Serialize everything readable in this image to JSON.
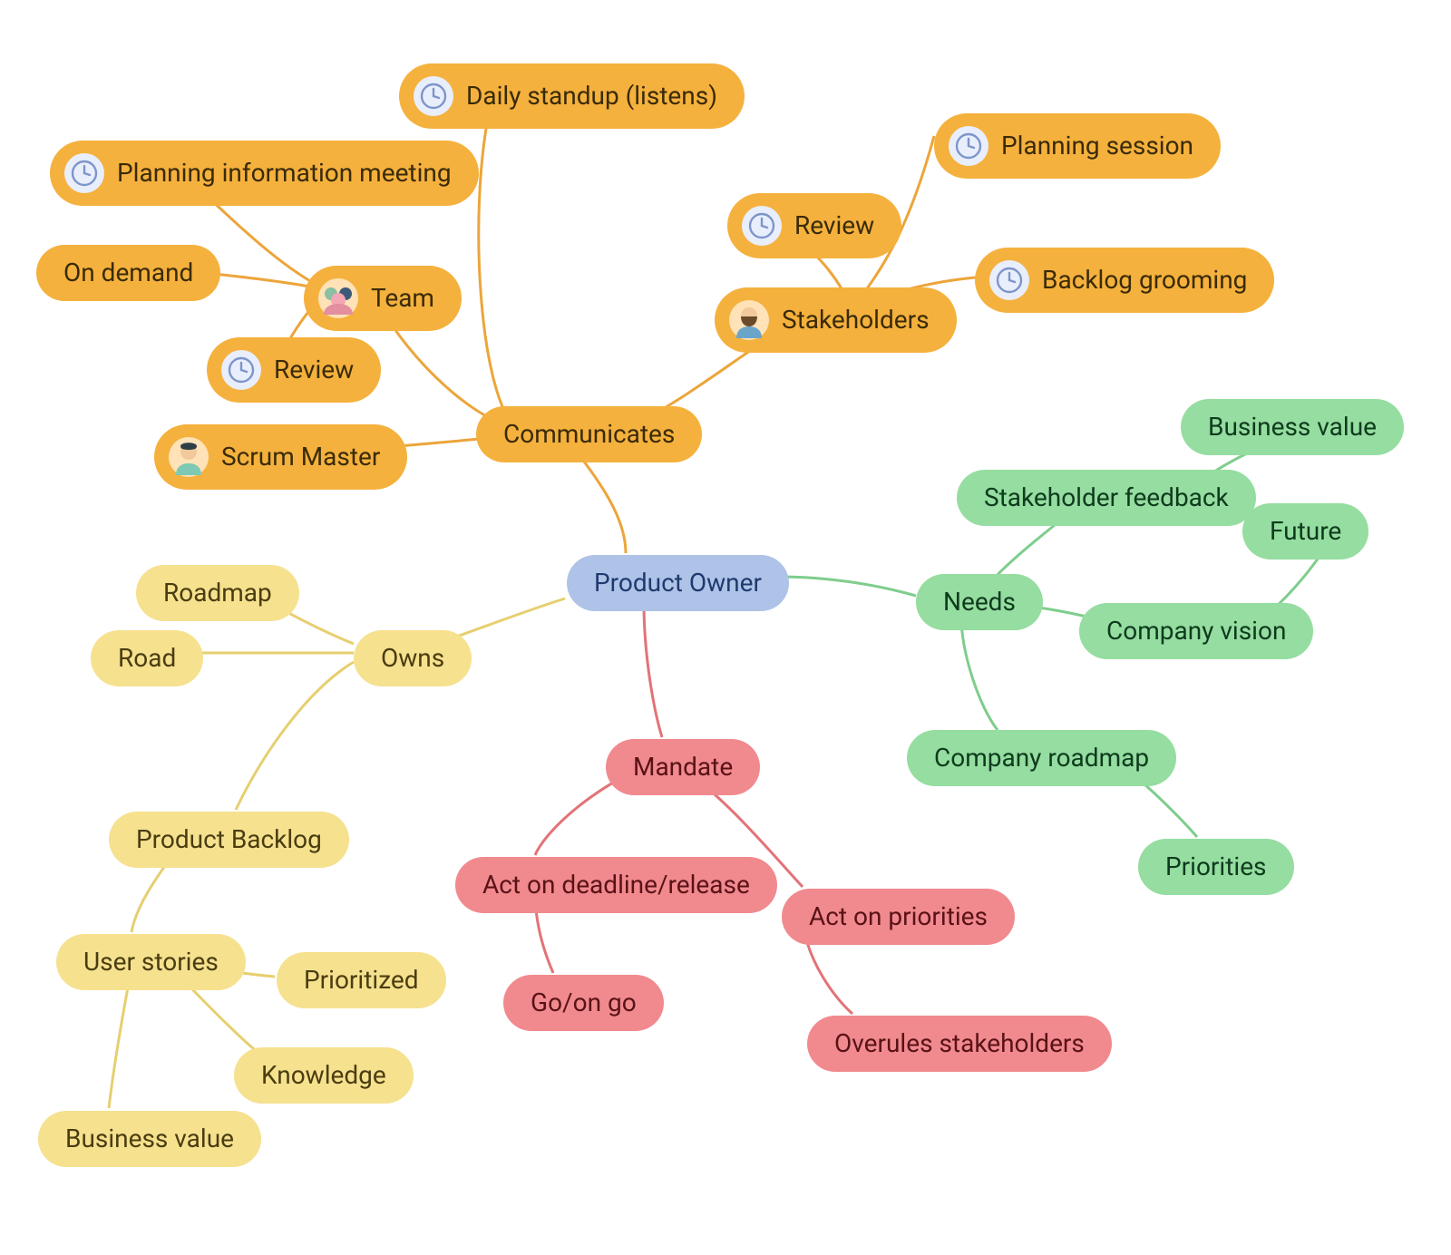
{
  "diagram_type": "mindmap",
  "colors": {
    "center": "#aec3e7",
    "communicates": "#f5b13d",
    "owns": "#f6e18f",
    "mandate": "#f08a8f",
    "needs": "#95dda0"
  },
  "center": {
    "label": "Product Owner"
  },
  "communicates": {
    "label": "Communicates",
    "team": {
      "label": "Team",
      "planning_info": "Planning information meeting",
      "daily_standup": "Daily standup (listens)",
      "on_demand": "On demand",
      "review": "Review"
    },
    "stakeholders": {
      "label": "Stakeholders",
      "review": "Review",
      "planning_session": "Planning session",
      "backlog_grooming": "Backlog grooming"
    },
    "scrum_master": "Scrum Master"
  },
  "owns": {
    "label": "Owns",
    "roadmap": "Roadmap",
    "road": "Road",
    "product_backlog": {
      "label": "Product Backlog",
      "user_stories": {
        "label": "User stories",
        "prioritized": "Prioritized",
        "knowledge": "Knowledge",
        "business_value": "Business value"
      }
    }
  },
  "mandate": {
    "label": "Mandate",
    "act_deadline": {
      "label": "Act on deadline/release",
      "go_no_go": "Go/on go"
    },
    "act_priorities": {
      "label": "Act on priorities",
      "overrules": "Overules stakeholders"
    }
  },
  "needs": {
    "label": "Needs",
    "stakeholder_feedback": {
      "label": "Stakeholder feedback",
      "business_value": "Business value"
    },
    "company_vision": {
      "label": "Company vision",
      "future": "Future"
    },
    "company_roadmap": {
      "label": "Company roadmap",
      "priorities": "Priorities"
    }
  }
}
